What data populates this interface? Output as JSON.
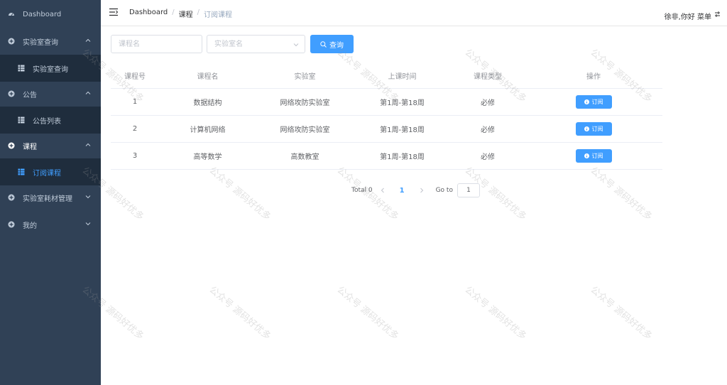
{
  "sidebar": {
    "items": [
      {
        "label": "Dashboard",
        "icon": "dashboard-icon"
      },
      {
        "label": "实验室查询",
        "icon": "plus-circle-icon"
      },
      {
        "label": "实验室查询",
        "icon": "table-icon"
      },
      {
        "label": "公告",
        "icon": "plus-circle-icon"
      },
      {
        "label": "公告列表",
        "icon": "table-icon"
      },
      {
        "label": "课程",
        "icon": "plus-circle-icon"
      },
      {
        "label": "订阅课程",
        "icon": "table-icon"
      },
      {
        "label": "实验室耗材管理",
        "icon": "plus-circle-icon"
      },
      {
        "label": "我的",
        "icon": "plus-circle-icon"
      }
    ],
    "bg_color": "#304156",
    "submenu_bg_color": "#1f2d3d",
    "active_color": "#409eff"
  },
  "header": {
    "breadcrumb": [
      "Dashboard",
      "课程",
      "订阅课程"
    ],
    "user_text": "徐非,你好 菜单"
  },
  "filters": {
    "course_placeholder": "课程名",
    "lab_placeholder": "实验室名",
    "search_label": "查询"
  },
  "table": {
    "columns": [
      "课程号",
      "课程名",
      "实验室",
      "上课时间",
      "课程类型",
      "操作"
    ],
    "rows": [
      {
        "id": "1",
        "name": "数据结构",
        "lab": "网络攻防实验室",
        "time": "第1周-第18周",
        "type": "必修",
        "action": "订阅"
      },
      {
        "id": "2",
        "name": "计算机网络",
        "lab": "网络攻防实验室",
        "time": "第1周-第18周",
        "type": "必修",
        "action": "订阅"
      },
      {
        "id": "3",
        "name": "高等数学",
        "lab": "高数教室",
        "time": "第1周-第18周",
        "type": "必修",
        "action": "订阅"
      }
    ]
  },
  "pagination": {
    "total": "Total 0",
    "current_page": "1",
    "goto_label": "Go to",
    "goto_value": "1"
  },
  "watermark": "公众号 源码好优多",
  "accent_color": "#409eff"
}
